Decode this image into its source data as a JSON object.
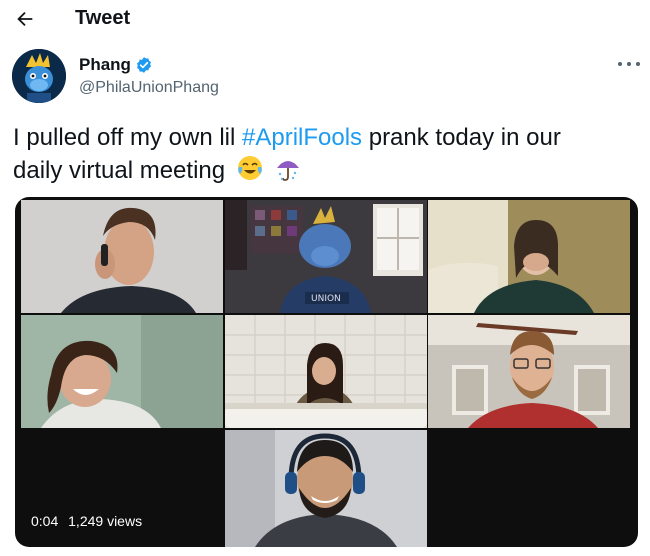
{
  "header": {
    "title": "Tweet",
    "back_icon": "arrow-left-icon"
  },
  "author": {
    "display_name": "Phang",
    "handle": "@PhilaUnionPhang",
    "verified_icon": "verified-badge-icon",
    "verified_color": "#1d9bf0",
    "more_icon": "more-dots-icon"
  },
  "tweet": {
    "text_before": "I pulled off my own lil ",
    "hashtag": "#AprilFools",
    "text_after_line1": " prank today in our",
    "text_line2": "daily virtual meeting",
    "emoji": [
      "face-with-tears-of-joy",
      "umbrella-with-rain"
    ],
    "hashtag_color": "#1d9bf0"
  },
  "media": {
    "type": "video",
    "timestamp": "0:04",
    "views": "1,249 views",
    "participants": [
      "man-on-phone",
      "mascot-in-room",
      "woman-covering-mouth",
      "woman-laughing",
      "woman-in-bathtub",
      "man-with-glasses",
      "man-with-headphones"
    ]
  }
}
